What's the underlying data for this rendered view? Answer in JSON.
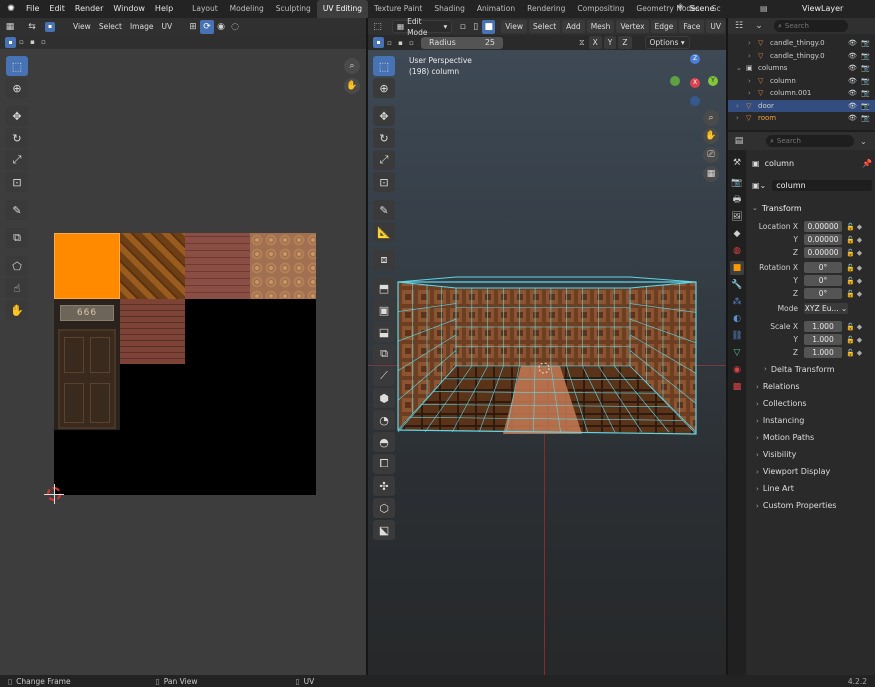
{
  "topbar": {
    "menus": [
      "File",
      "Edit",
      "Render",
      "Window",
      "Help"
    ],
    "workspaces": [
      "Layout",
      "Modeling",
      "Sculpting",
      "UV Editing",
      "Texture Paint",
      "Shading",
      "Animation",
      "Rendering",
      "Compositing",
      "Geometry Nodes",
      "Sc"
    ],
    "active_workspace": "UV Editing",
    "scene": "Scene",
    "view_layer": "ViewLayer"
  },
  "uv_editor": {
    "menus": [
      "View",
      "Select",
      "Image",
      "UV"
    ],
    "door_number": "666",
    "tools": [
      "select-box-icon",
      "cursor-icon",
      "move-icon",
      "rotate-icon",
      "scale-icon",
      "transform-icon",
      "annotate-icon",
      "rip-icon",
      "grab-icon",
      "relax-icon",
      "pinch-icon"
    ]
  },
  "viewport": {
    "mode": "Edit Mode",
    "menus": [
      "View",
      "Select",
      "Add",
      "Mesh",
      "Vertex",
      "Edge",
      "Face",
      "UV"
    ],
    "radius_label": "Radius",
    "radius_value": "25",
    "axes": [
      "X",
      "Y",
      "Z"
    ],
    "options_label": "Options",
    "perspective_label": "User Perspective",
    "object_label": "(198) column",
    "gizmo": {
      "z": "Z",
      "y": "Y",
      "x": "X"
    }
  },
  "outliner": {
    "search_placeholder": "Search",
    "items": [
      {
        "name": "candle_thingy.0",
        "indent": 2
      },
      {
        "name": "candle_thingy.0",
        "indent": 2
      },
      {
        "name": "columns",
        "indent": 1
      },
      {
        "name": "column",
        "indent": 2
      },
      {
        "name": "column.001",
        "indent": 2
      },
      {
        "name": "door",
        "indent": 1,
        "selected": true
      },
      {
        "name": "room",
        "indent": 1
      }
    ]
  },
  "properties": {
    "search_placeholder": "Search",
    "object_name": "column",
    "data_name": "column",
    "transform_label": "Transform",
    "location_label": "Location X",
    "location": [
      "0.00000",
      "0.00000",
      "0.00000"
    ],
    "rotation_label": "Rotation X",
    "rotation": [
      "0°",
      "0°",
      "0°"
    ],
    "mode_label": "Mode",
    "mode_value": "XYZ Eu...",
    "scale_label": "Scale X",
    "scale": [
      "1.000",
      "1.000",
      "1.000"
    ],
    "axis_y": "Y",
    "axis_z": "Z",
    "delta_transform": "Delta Transform",
    "panels": [
      "Relations",
      "Collections",
      "Instancing",
      "Motion Paths",
      "Visibility",
      "Viewport Display",
      "Line Art",
      "Custom Properties"
    ]
  },
  "statusbar": {
    "items": [
      "Change Frame",
      "Pan View",
      "UV"
    ],
    "version": "4.2.2"
  },
  "colors": {
    "accent": "#4772b3",
    "selected_face": "#ff8a00",
    "mesh_wire": "#5fd6e6",
    "uv_background": "#3d3d3d"
  }
}
